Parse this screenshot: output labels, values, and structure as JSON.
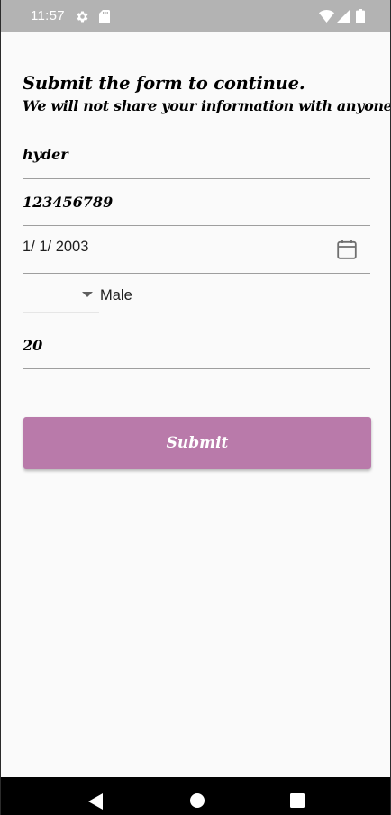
{
  "status_bar": {
    "time": "11:57",
    "icons": [
      "gear-icon",
      "sd-card-icon",
      "wifi-icon",
      "signal-icon",
      "battery-icon"
    ]
  },
  "form": {
    "heading": "Submit the form to continue.",
    "subheading": "We will not share your information with anyone.",
    "name_value": "hyder",
    "phone_value": "123456789",
    "date_value": "1/ 1/ 2003",
    "gender_value": "Male",
    "age_value": "20",
    "submit_label": "Submit"
  },
  "colors": {
    "status_bar": "#b3b3b3",
    "background": "#fafafa",
    "accent_button": "#b97aaa",
    "underline": "#9e9e9e",
    "nav_bar": "#000000"
  },
  "nav_bar": {
    "icons": [
      "back-icon",
      "home-icon",
      "recents-icon"
    ]
  }
}
